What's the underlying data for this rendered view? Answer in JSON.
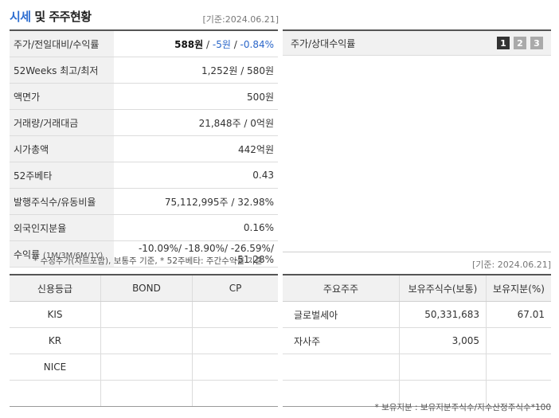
{
  "header": {
    "title_highlight": "시세",
    "title_rest": " 및 주주현황",
    "as_of": "[기준:2024.06.21]"
  },
  "price_rows": [
    {
      "label": "주가/전일대비/수익률",
      "value_main": "588원",
      "sep1": " / ",
      "value_change": "-5원",
      "sep2": " / ",
      "value_rate": "-0.84%"
    },
    {
      "label": "52Weeks 최고/최저",
      "value": "1,252원 / 580원"
    },
    {
      "label": "액면가",
      "value": "500원"
    },
    {
      "label": "거래량/거래대금",
      "value": "21,848주 / 0억원"
    },
    {
      "label": "시가총액",
      "value": "442억원"
    },
    {
      "label": "52주베타",
      "value": "0.43"
    },
    {
      "label": "발행주식수/유동비율",
      "value": "75,112,995주 / 32.98%"
    },
    {
      "label": "외국인지분율",
      "value": "0.16%"
    },
    {
      "label": "수익률",
      "label_small": "(1M/3M/6M/1Y)",
      "returns": [
        "-10.09%",
        "-18.90%",
        "-26.59%",
        "-51.28%"
      ]
    }
  ],
  "price_note": "* 수정주가(차트포함), 보통주 기준, * 52주베타: 주간수익률 기준",
  "chart_panel": {
    "title": "주가/상대수익률",
    "pages": [
      "1",
      "2",
      "3"
    ],
    "active_page": "1",
    "as_of": "[기준: 2024.06.21]"
  },
  "credit_table": {
    "headers": [
      "신용등급",
      "BOND",
      "CP"
    ],
    "rows": [
      [
        "KIS",
        "",
        ""
      ],
      [
        "KR",
        "",
        ""
      ],
      [
        "NICE",
        "",
        ""
      ],
      [
        "",
        "",
        ""
      ]
    ]
  },
  "holders_table": {
    "headers": [
      "주요주주",
      "보유주식수(보통)",
      "보유지분(%)"
    ],
    "rows": [
      [
        "글로벌세아",
        "50,331,683",
        "67.01"
      ],
      [
        "자사주",
        "3,005",
        ""
      ],
      [
        "",
        "",
        ""
      ],
      [
        "",
        "",
        ""
      ]
    ]
  },
  "holders_note": "* 보유지분 : 보유지분주식수/지수산정주식수*100",
  "colors": {
    "negative": "#2a66c9",
    "title_highlight": "#2f6fd1",
    "label_bg": "#f1f1f1"
  }
}
